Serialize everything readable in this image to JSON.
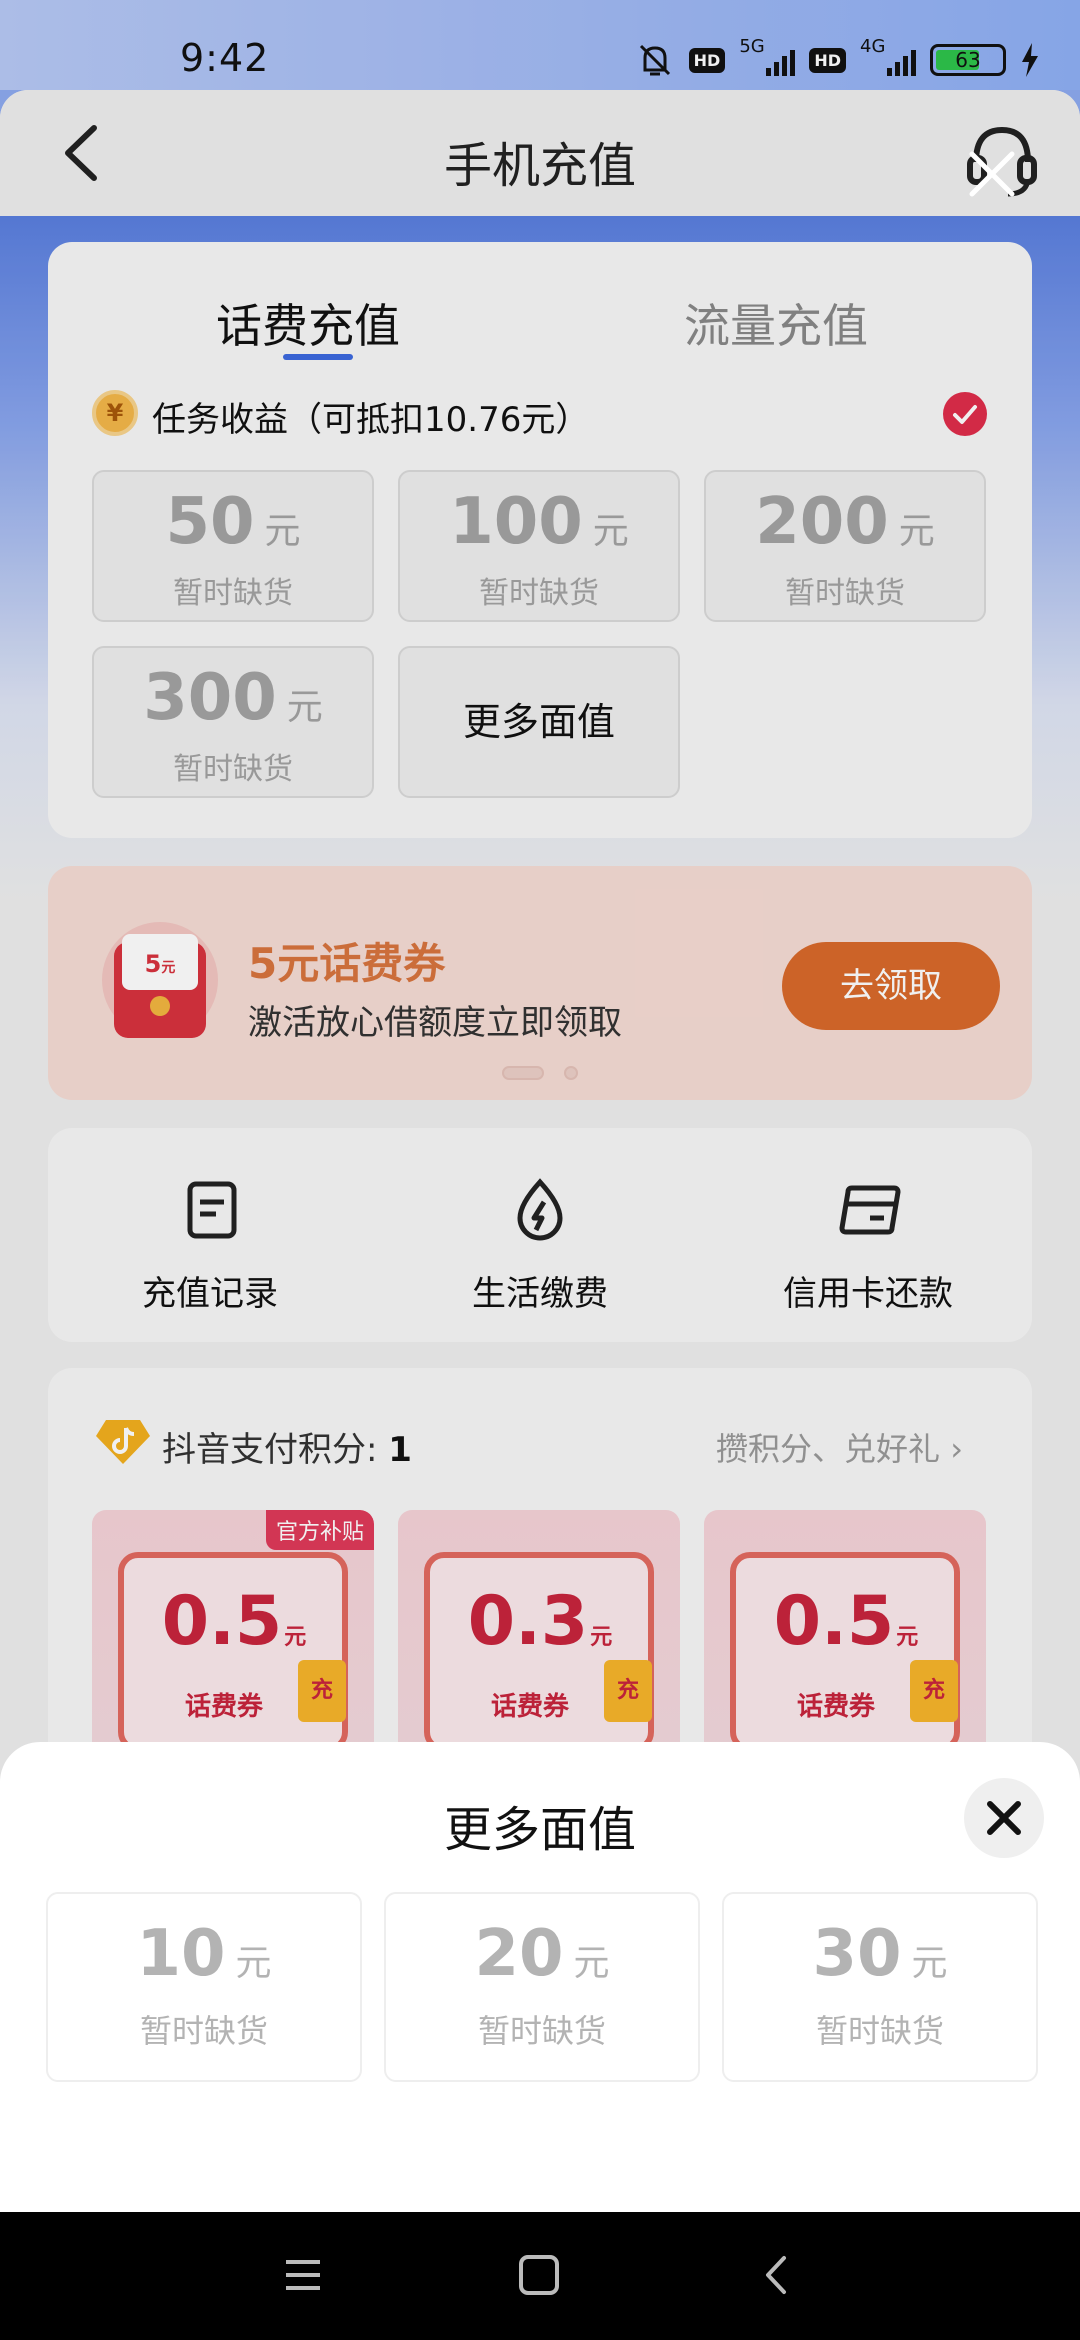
{
  "status": {
    "time": "9:42",
    "net1": "5G",
    "net2": "4G",
    "battery": "63",
    "hd": "HD"
  },
  "header": {
    "title": "手机充值"
  },
  "tabs": [
    {
      "label": "话费充值"
    },
    {
      "label": "流量充值"
    }
  ],
  "task": {
    "coin": "¥",
    "label": "任务收益（可抵扣10.76元）"
  },
  "amounts": [
    {
      "value": "50",
      "unit": "元",
      "status": "暂时缺货"
    },
    {
      "value": "100",
      "unit": "元",
      "status": "暂时缺货"
    },
    {
      "value": "200",
      "unit": "元",
      "status": "暂时缺货"
    },
    {
      "value": "300",
      "unit": "元",
      "status": "暂时缺货"
    }
  ],
  "more_label": "更多面值",
  "promo": {
    "icon_text": "5元",
    "title": "5元话费券",
    "subtitle": "激活放心借额度立即领取",
    "button": "去领取"
  },
  "shortcuts": [
    {
      "label": "充值记录"
    },
    {
      "label": "生活缴费"
    },
    {
      "label": "信用卡还款"
    }
  ],
  "points": {
    "label": "抖音支付积分: ",
    "value": "1",
    "link": "攒积分、兑好礼"
  },
  "coupons": [
    {
      "tag": "官方补贴",
      "value": "0.5",
      "unit": "元",
      "name": "话费券",
      "badge": "充"
    },
    {
      "tag": "",
      "value": "0.3",
      "unit": "元",
      "name": "话费券",
      "badge": "充"
    },
    {
      "tag": "",
      "value": "0.5",
      "unit": "元",
      "name": "话费券",
      "badge": "充"
    }
  ],
  "sheet": {
    "title": "更多面值",
    "amounts": [
      {
        "value": "10",
        "unit": "元",
        "status": "暂时缺货"
      },
      {
        "value": "20",
        "unit": "元",
        "status": "暂时缺货"
      },
      {
        "value": "30",
        "unit": "元",
        "status": "暂时缺货"
      }
    ]
  },
  "colors": {
    "accent": "#3d6ae0",
    "check": "#e02d4b",
    "promo_button": "#d96a2b",
    "coupon_red": "#c8253d"
  }
}
